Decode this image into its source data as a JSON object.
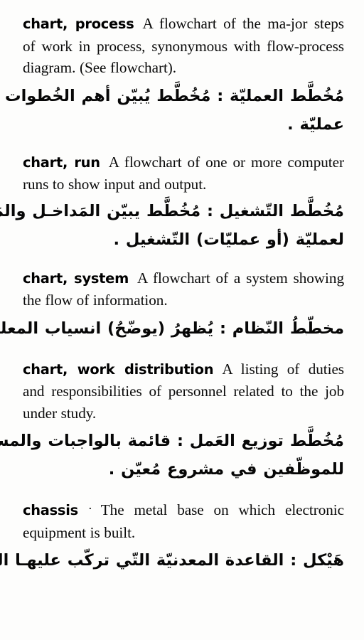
{
  "page": {
    "language_pair": "English-Arabic",
    "background_color": "#fdfdfc",
    "text_color": "#050505"
  },
  "entries": [
    {
      "headword": "chart, process",
      "separator": "",
      "definition": "A flowchart of the ma-jor steps of work in process, synonymous with flow-process diagram. (See flowchart).",
      "definition_lines": [
        "A flowchart of the ma-",
        "jor steps of work in process, synonymous",
        "with        flow-process        diagram.        (See",
        "flowchart)."
      ],
      "arabic_lines": [
        "مُخُطَّط العمليّة : مُخُطَّط يُبيّن أهم الخُطوات لتنفيذ",
        "عمليّة ."
      ]
    },
    {
      "headword": "chart, run",
      "separator": "",
      "definition": "A flowchart of one or more computer runs to show input and output.",
      "definition_lines": [
        "A flowchart of one or more",
        "computer runs to show input and output."
      ],
      "arabic_lines": [
        "مُخُطَّط التّشغيل : مُخُطَّط يبيّن المَداخـل والمَخـارج",
        "لعمليّة (أو عمليّات) التّشغيل ."
      ]
    },
    {
      "headword": "chart, system",
      "separator": "",
      "definition": "A flowchart of a system showing the flow of information.",
      "definition_lines": [
        "A flowchart of a system",
        "showing the flow of information."
      ],
      "arabic_lines": [
        "مخطّطُ النّظام : يُظهرُ (يوضّحُ) انسياب المعلومات ."
      ]
    },
    {
      "headword": "chart, work distribution",
      "separator": "",
      "definition": "A listing of duties and responsibilities of personnel related to the job under study.",
      "definition_lines": [
        "A listing of",
        "duties and responsibilities of personnel re-",
        "lated to the job under study."
      ],
      "arabic_lines": [
        "مُخُطَّط توزيع العَمل : قائمة بالواجبات والمسئوليّات",
        "للموظّفين في مشروع مُعيّن ."
      ]
    },
    {
      "headword": "chassis",
      "separator": "·",
      "definition": "The metal base on which electronic equipment is built.",
      "definition_lines": [
        "The metal base on which elec-",
        "tronic equipment is built."
      ],
      "arabic_lines": [
        "هَيْكل : القاعدة المعدنيّة التّي تركّب عليهـا المُعدّات"
      ]
    }
  ]
}
